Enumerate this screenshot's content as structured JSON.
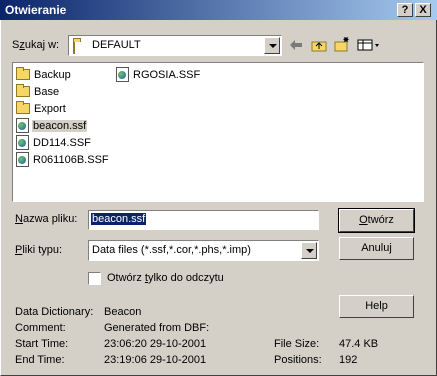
{
  "window": {
    "title": "Otwieranie",
    "help_btn": "?",
    "close_btn": "X"
  },
  "lookin": {
    "label_pre": "S",
    "label_u": "z",
    "label_post": "ukaj w:",
    "value": "DEFAULT"
  },
  "toolbar": {
    "icons": [
      "back-arrow-icon",
      "up-folder-icon",
      "new-folder-icon",
      "view-menu-icon"
    ]
  },
  "files": [
    {
      "name": "Backup",
      "type": "folder"
    },
    {
      "name": "Base",
      "type": "folder"
    },
    {
      "name": "Export",
      "type": "folder"
    },
    {
      "name": "beacon.ssf",
      "type": "file",
      "selected": true
    },
    {
      "name": "DD114.SSF",
      "type": "file"
    },
    {
      "name": "R061106B.SSF",
      "type": "file"
    },
    {
      "name": "RGOSIA.SSF",
      "type": "file"
    }
  ],
  "filename": {
    "label_u": "N",
    "label_rest": "azwa pliku:",
    "value": "beacon.ssf"
  },
  "filetype": {
    "label_u": "P",
    "label_rest": "liki typu:",
    "value": "Data files (*.ssf,*.cor,*.phs,*.imp)"
  },
  "readonly": {
    "pre": "Otwórz ",
    "u": "t",
    "post": "ylko do odczytu"
  },
  "buttons": {
    "open_u": "O",
    "open_rest": "twórz",
    "cancel": "Anuluj",
    "help": "Help"
  },
  "info": {
    "dd_label": "Data Dictionary:",
    "dd_value": "Beacon",
    "comment_label": "Comment:",
    "comment_value": "Generated from DBF:",
    "start_label": "Start Time:",
    "start_value": "23:06:20 29-10-2001",
    "end_label": "End Time:",
    "end_value": "23:19:06 29-10-2001",
    "size_label": "File Size:",
    "size_value": "47.4 KB",
    "pos_label": "Positions:",
    "pos_value": "192"
  }
}
